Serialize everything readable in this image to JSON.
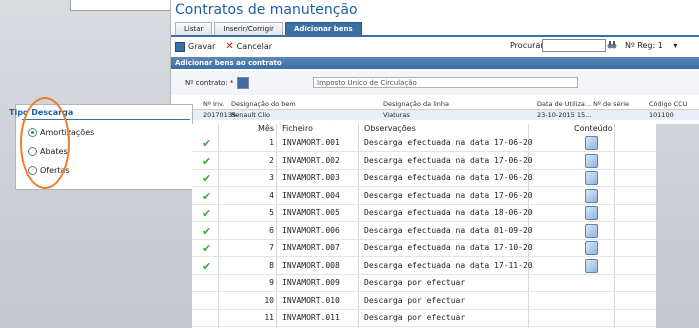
{
  "window": {
    "title": "Contratos de manutenção"
  },
  "tabs": [
    {
      "label": "Listar"
    },
    {
      "label": "Inserir/Corrigir"
    },
    {
      "label": "Adicionar bens"
    }
  ],
  "toolbar": {
    "save_label": "Gravar",
    "cancel_label": "Cancelar",
    "search_label": "Procurar:",
    "reg_label": "Nº Reg: 1"
  },
  "section": {
    "title": "Adicionar bens ao contrato"
  },
  "contrato": {
    "label": "Nº contrato: *",
    "description": "Imposto Unico de Circulação"
  },
  "bens_table": {
    "headers": [
      "Nº Inv.",
      "Designação do bem",
      "Designação da linha",
      "Data de Utiliza...",
      "Nº de série",
      "Código CCU"
    ],
    "row": [
      "20170135",
      "Renault Clio",
      "Viaturas",
      "23-10-2015 15...",
      "",
      "101100"
    ]
  },
  "tipo_descarga": {
    "title": "Tipo Descarga",
    "options": [
      {
        "label": "Amortizações",
        "selected": true
      },
      {
        "label": "Abates",
        "selected": false
      },
      {
        "label": "Ofertas",
        "selected": false
      }
    ]
  },
  "descargas": {
    "headers": {
      "mes": "Mês",
      "ficheiro": "Ficheiro",
      "obs": "Observações",
      "conteudo": "Conteúdo"
    },
    "rows": [
      {
        "done": true,
        "mes": "1",
        "ficheiro": "INVAMORT.001",
        "obs": "Descarga efectuada na data 17-06-20"
      },
      {
        "done": true,
        "mes": "2",
        "ficheiro": "INVAMORT.002",
        "obs": "Descarga efectuada na data 17-06-20"
      },
      {
        "done": true,
        "mes": "3",
        "ficheiro": "INVAMORT.003",
        "obs": "Descarga efectuada na data 17-06-20"
      },
      {
        "done": true,
        "mes": "4",
        "ficheiro": "INVAMORT.004",
        "obs": "Descarga efectuada na data 17-06-20"
      },
      {
        "done": true,
        "mes": "5",
        "ficheiro": "INVAMORT.005",
        "obs": "Descarga efectuada na data 18-06-20"
      },
      {
        "done": true,
        "mes": "6",
        "ficheiro": "INVAMORT.006",
        "obs": "Descarga efectuada na data 01-09-20"
      },
      {
        "done": true,
        "mes": "7",
        "ficheiro": "INVAMORT.007",
        "obs": "Descarga efectuada na data 17-10-20"
      },
      {
        "done": true,
        "mes": "8",
        "ficheiro": "INVAMORT.008",
        "obs": "Descarga efectuada na data 17-11-20"
      },
      {
        "done": false,
        "mes": "9",
        "ficheiro": "INVAMORT.009",
        "obs": "Descarga por efectuar"
      },
      {
        "done": false,
        "mes": "10",
        "ficheiro": "INVAMORT.010",
        "obs": "Descarga por efectuar"
      },
      {
        "done": false,
        "mes": "11",
        "ficheiro": "INVAMORT.011",
        "obs": "Descarga por efectuar"
      }
    ]
  },
  "colors": {
    "accent": "#3c6fa6",
    "highlight": "#f07c2a",
    "check": "#3aa63a"
  }
}
